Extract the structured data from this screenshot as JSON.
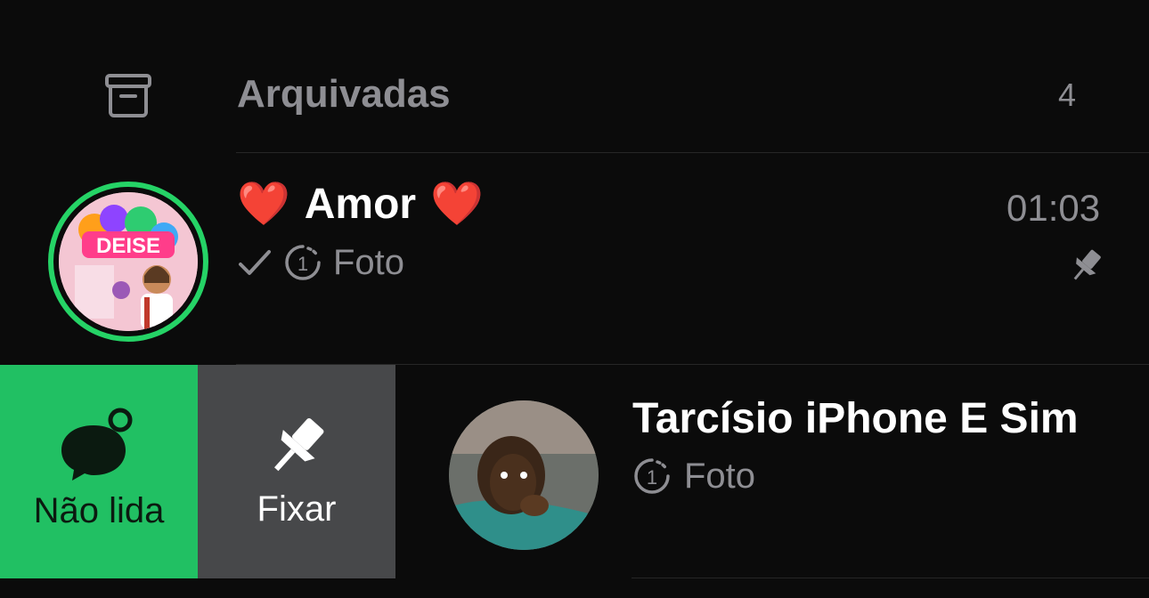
{
  "archived": {
    "label": "Arquivadas",
    "count": "4",
    "icon": "archive-icon"
  },
  "chats": [
    {
      "name_heart_left": "❤️",
      "name": "Amor",
      "name_heart_right": "❤️",
      "time": "01:03",
      "status_icon": "checkmark-icon",
      "view_once_icon": "view-once-icon",
      "preview": "Foto",
      "pinned": true,
      "avatar_text": "DEISE",
      "status_ring_color": "#25d366"
    },
    {
      "name": "Tarcísio iPhone E Sim",
      "view_once_icon": "view-once-icon",
      "preview": "Foto"
    }
  ],
  "swipe_actions": {
    "unread": {
      "label": "Não lida",
      "icon": "unread-chat-icon",
      "color": "#21c063"
    },
    "pin": {
      "label": "Fixar",
      "icon": "pin-icon",
      "color": "#47484a"
    }
  },
  "colors": {
    "background": "#0b0b0b",
    "secondary_text": "#8e8e93",
    "accent": "#25d366"
  }
}
